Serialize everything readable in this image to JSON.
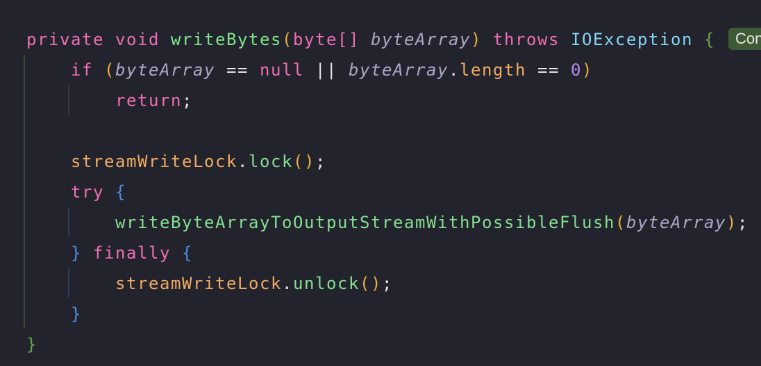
{
  "editor": {
    "lines": [
      {
        "tokens": [
          "private",
          "void",
          "writeBytes",
          "(",
          "byte[]",
          "byteArray",
          ")",
          "throws",
          "IOException",
          "{"
        ]
      },
      {
        "tokens": [
          "if",
          "(",
          "byteArray",
          "==",
          "null",
          "||",
          "byteArray",
          ".",
          "length",
          "==",
          "0",
          ")"
        ]
      },
      {
        "tokens": [
          "return",
          ";"
        ]
      },
      {
        "tokens": []
      },
      {
        "tokens": [
          "streamWriteLock",
          ".",
          "lock",
          "()",
          ";"
        ]
      },
      {
        "tokens": [
          "try",
          "{"
        ]
      },
      {
        "tokens": [
          "writeByteArrayToOutputStreamWithPossibleFlush",
          "(",
          "byteArray",
          ")",
          ";"
        ]
      },
      {
        "tokens": [
          "}",
          "finally",
          "{"
        ]
      },
      {
        "tokens": [
          "streamWriteLock",
          ".",
          "unlock",
          "()",
          ";"
        ]
      },
      {
        "tokens": [
          "}"
        ]
      },
      {
        "tokens": [
          "}"
        ]
      }
    ],
    "inlay_hint": "Con"
  }
}
